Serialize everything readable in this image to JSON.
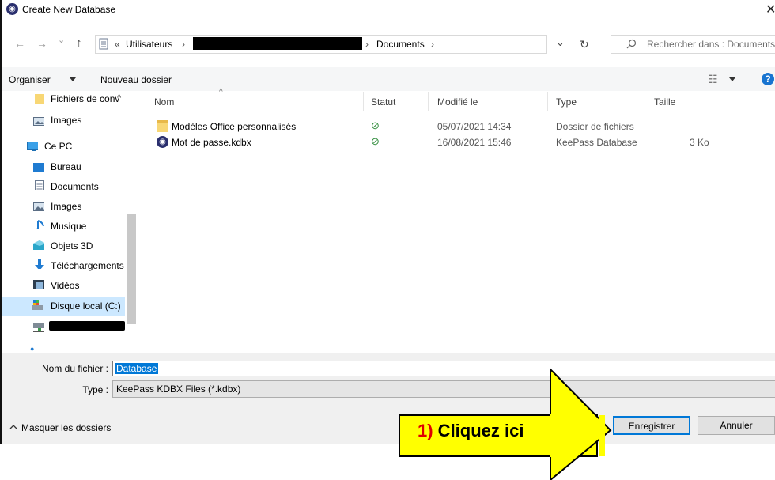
{
  "title_bar": {
    "title": "Create New Database",
    "close_glyph": "✕"
  },
  "address": {
    "back_glyph": "←",
    "forward_glyph": "→",
    "dropdown_glyph": "⌄",
    "up_glyph": "↑",
    "overflow_glyph": "«",
    "crumb1": "Utilisateurs",
    "crumb_sep": "›",
    "crumb3": "Documents",
    "refresh_glyph": "↻",
    "search_placeholder": "Rechercher dans : Documents"
  },
  "toolbar": {
    "organize_label": "Organiser",
    "new_folder_label": "Nouveau dossier",
    "view_glyph": "☷",
    "help_glyph": "?"
  },
  "nav_pane": {
    "items": [
      {
        "label": "Fichiers de conv",
        "icon": "folder-icon"
      },
      {
        "label": "Images",
        "icon": "images-icon"
      },
      {
        "label": "Ce PC",
        "icon": "computer-icon"
      },
      {
        "label": "Bureau",
        "icon": "desktop-icon"
      },
      {
        "label": "Documents",
        "icon": "documents-icon"
      },
      {
        "label": "Images",
        "icon": "images-icon"
      },
      {
        "label": "Musique",
        "icon": "music-icon"
      },
      {
        "label": "Objets 3D",
        "icon": "objects-3d-icon"
      },
      {
        "label": "Téléchargements",
        "icon": "download-icon"
      },
      {
        "label": "Vidéos",
        "icon": "video-icon"
      },
      {
        "label": "Disque local (C:)",
        "icon": "drive-icon"
      }
    ]
  },
  "file_list": {
    "columns": {
      "name": "Nom",
      "status": "Statut",
      "modified": "Modifié le",
      "type": "Type",
      "size": "Taille"
    },
    "sort_glyph": "^",
    "rows": [
      {
        "name": "Modèles Office personnalisés",
        "status": "⊘",
        "modified": "05/07/2021 14:34",
        "type": "Dossier de fichiers",
        "size": "",
        "icon": "folder-icon"
      },
      {
        "name": "Mot de passe.kdbx",
        "status": "⊘",
        "modified": "16/08/2021 15:46",
        "type": "KeePass Database",
        "size": "3 Ko",
        "icon": "keepass-icon"
      }
    ]
  },
  "save_panel": {
    "filename_label": "Nom du fichier :",
    "filename_value": "Database",
    "type_label": "Type :",
    "type_value": "KeePass KDBX Files (*.kdbx)",
    "hide_folders_label": "Masquer les dossiers",
    "save_label": "Enregistrer",
    "cancel_label": "Annuler"
  },
  "annotation": {
    "step": "1)",
    "text": " Cliquez ici"
  },
  "colors": {
    "accent": "#0078d7",
    "callout_fill": "#ffff00",
    "callout_step": "#e00000",
    "folder": "#f8d775",
    "status_ok": "#2e8b3a"
  }
}
